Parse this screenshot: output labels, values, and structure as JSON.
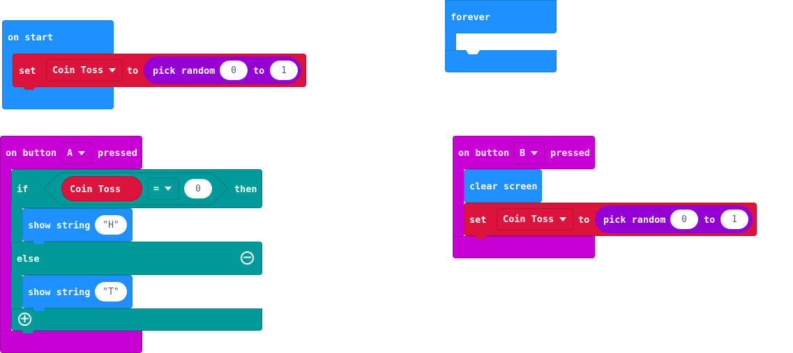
{
  "on_start": {
    "hat_label": "on start",
    "set_block": {
      "set_label": "set",
      "variable": "Coin Toss",
      "to_label": "to",
      "random": {
        "label": "pick random",
        "min": "0",
        "to_label": "to",
        "max": "1"
      }
    }
  },
  "forever": {
    "hat_label": "forever"
  },
  "button_a": {
    "on_label": "on button",
    "button": "A",
    "pressed_label": "pressed",
    "if_label": "if",
    "condition": {
      "variable": "Coin Toss",
      "operator": "=",
      "value": "0"
    },
    "then_label": "then",
    "show_then": {
      "label": "show string",
      "text": "\"H\""
    },
    "else_label": "else",
    "show_else": {
      "label": "show string",
      "text": "\"T\""
    },
    "remove_icon": "minus-circle-icon",
    "add_icon": "plus-circle-icon"
  },
  "button_b": {
    "on_label": "on button",
    "button": "B",
    "pressed_label": "pressed",
    "clear_label": "clear screen",
    "set_block": {
      "set_label": "set",
      "variable": "Coin Toss",
      "to_label": "to",
      "random": {
        "label": "pick random",
        "min": "0",
        "to_label": "to",
        "max": "1"
      }
    }
  },
  "colors": {
    "basic_blue": "#1e90ff",
    "variables_red": "#dc143c",
    "input_magenta": "#c800d6",
    "logic_teal": "#009a9a",
    "math_purple": "#9400d3"
  }
}
